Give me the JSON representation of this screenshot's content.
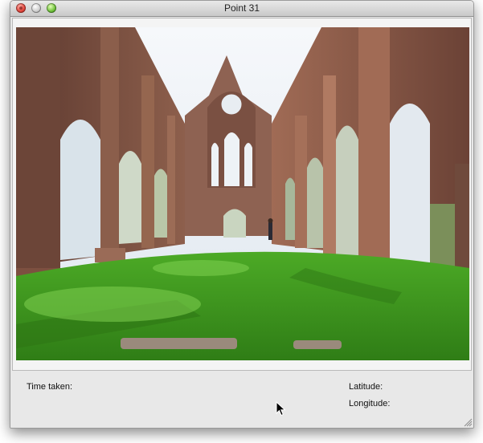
{
  "window": {
    "title": "Point 31"
  },
  "photo": {
    "subject": "abbey-ruins-photo",
    "colors": {
      "grass": "#3f9c1e",
      "stone": "#8a5a48",
      "sky": "#e9eef4"
    }
  },
  "info": {
    "time_label": "Time taken:",
    "latitude_label": "Latitude:",
    "longitude_label": "Longitude:"
  },
  "icons": {
    "close": "close-icon",
    "minimize": "minimize-icon",
    "zoom": "zoom-icon",
    "resize": "resize-grip-icon",
    "cursor": "arrow-cursor-icon"
  }
}
